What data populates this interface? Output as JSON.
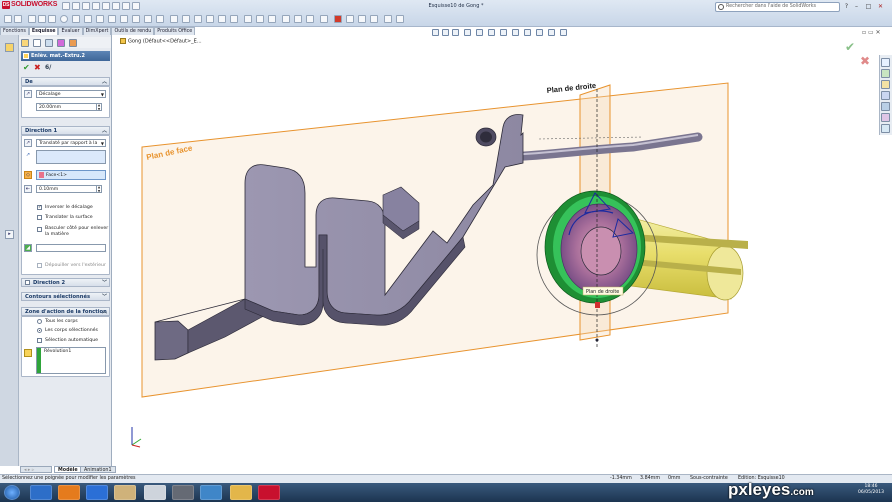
{
  "app": {
    "brand": "SOLIDWORKS",
    "document_title": "Esquisse10 de Gong *",
    "search_placeholder": "Rechercher dans l'aide de SolidWorks"
  },
  "command_tabs": [
    "Fonctions",
    "Esquisse",
    "Evaluer",
    "DimXpert",
    "Outils de rendu",
    "Produits Office"
  ],
  "active_command_tab": "Esquisse",
  "tree_root": "Gong (Défaut<<Défaut>_E...",
  "property_manager": {
    "title": "Enlèv. mat.-Extru.2",
    "ok_label": "✔",
    "cancel_label": "✖",
    "preview_label": "6/"
  },
  "de_group": {
    "header": "De",
    "condition": "Décalage",
    "offset": "20.00mm"
  },
  "direction1": {
    "header": "Direction 1",
    "end_condition": "Translaté par rapport à la",
    "face_value": "Face<1>",
    "offset": "0.10mm",
    "options": [
      {
        "label": "Inverser le décalage",
        "checked": true
      },
      {
        "label": "Translater la surface",
        "checked": false
      },
      {
        "label": "Basculer côté pour enlever la matière",
        "checked": false
      }
    ],
    "draft_label": "Dépouiller vers l'extérieur"
  },
  "direction2": {
    "header": "Direction 2"
  },
  "contours": {
    "header": "Contours sélectionnés"
  },
  "zone": {
    "header": "Zone d'action de la fonction",
    "options": [
      {
        "label": "Tous les corps",
        "selected": false
      },
      {
        "label": "Les corps sélectionnés",
        "selected": true
      }
    ],
    "auto_select_label": "Sélection automatique",
    "auto_select_checked": false,
    "bodies": [
      "Révolution1"
    ]
  },
  "viewport": {
    "plane_face_label": "Plan de face",
    "plane_right_label": "Plan de droite",
    "tooltip": "Plan de droite"
  },
  "bottom_tabs": [
    "Modèle",
    "Animation1"
  ],
  "active_bottom_tab": "Modèle",
  "status": {
    "message": "Sélectionnez une poignée pour modifier les paramètres",
    "x": "-1.34mm",
    "y": "3.84mm",
    "z": "0mm",
    "constraint": "Sous-contrainte",
    "edition": "Edition: Esquisse10"
  },
  "clock": {
    "time": "18:46",
    "date": "06/05/2013"
  },
  "watermark": {
    "main": "pxleyes",
    "suffix": ".com"
  },
  "colors": {
    "plane": "#e8932e",
    "part": "#8f8aa3",
    "tube": "#e8e06a",
    "ring": "#2fb24a",
    "accent": "#3e6698"
  }
}
